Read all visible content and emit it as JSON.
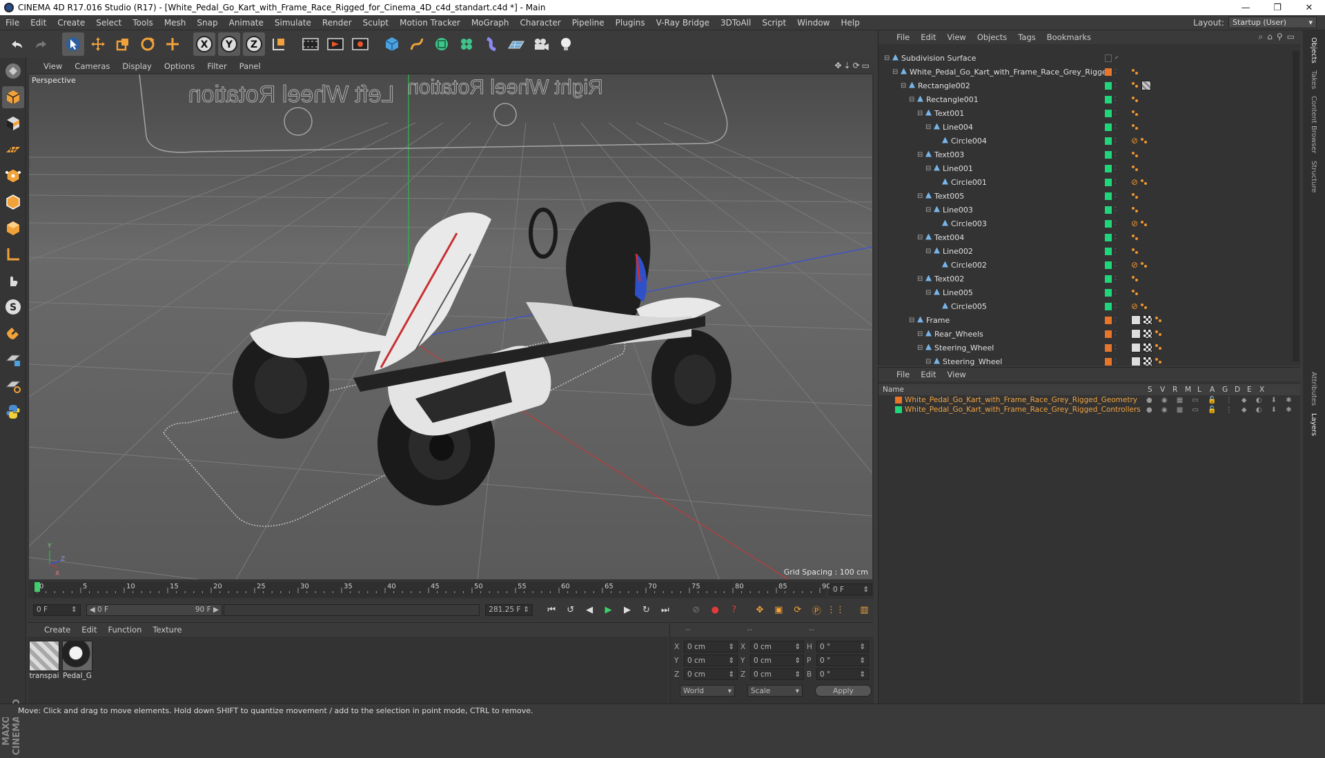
{
  "window": {
    "title": "CINEMA 4D R17.016 Studio (R17) - [White_Pedal_Go_Kart_with_Frame_Race_Rigged_for_Cinema_4D_c4d_standart.c4d *] - Main",
    "minimize": "—",
    "maximize": "❐",
    "close": "✕"
  },
  "menubar": {
    "items": [
      "File",
      "Edit",
      "Create",
      "Select",
      "Tools",
      "Mesh",
      "Snap",
      "Animate",
      "Simulate",
      "Render",
      "Sculpt",
      "Motion Tracker",
      "MoGraph",
      "Character",
      "Pipeline",
      "Plugins",
      "V-Ray Bridge",
      "3DToAll",
      "Script",
      "Window",
      "Help"
    ],
    "layout_label": "Layout:",
    "layout_value": "Startup (User)"
  },
  "toolbar": {
    "icons": [
      "undo-icon",
      "redo-icon",
      "select-icon",
      "move-icon",
      "scale-icon",
      "rotate-icon",
      "recent-tool-icon",
      "x-axis-icon",
      "y-axis-icon",
      "z-axis-icon",
      "world-coords-icon",
      "render-view-icon",
      "render-queue-icon",
      "render-settings-icon",
      "cube-icon",
      "pen-icon",
      "subdivision-icon",
      "cloner-icon",
      "deformer-icon",
      "floor-icon",
      "camera-icon",
      "light-icon"
    ],
    "axis_labels": [
      "X",
      "Y",
      "Z"
    ]
  },
  "left_tools": [
    "make-editable-icon",
    "model-mode-icon",
    "texture-mode-icon",
    "workplane-icon",
    "points-mode-icon",
    "edges-mode-icon",
    "polygons-mode-icon",
    "axis-mode-icon",
    "tweak-icon",
    "snap-icon",
    "magnet-icon",
    "grid-lock-icon",
    "grid-snap-icon",
    "python-icon"
  ],
  "maxon_logo": "MAXON CINEMA 4D",
  "viewport": {
    "menu": [
      "View",
      "Cameras",
      "Display",
      "Options",
      "Filter",
      "Panel"
    ],
    "label": "Perspective",
    "grid_spacing": "Grid Spacing : 100 cm",
    "overlay_text_left": "Left Wheel Rotation",
    "overlay_text_right": "Right Wheel Rotation",
    "axis_y": "Y",
    "axis_z": "Z",
    "axis_x": "X"
  },
  "timeline": {
    "ticks": [
      "0",
      "5",
      "10",
      "15",
      "20",
      "25",
      "30",
      "35",
      "40",
      "45",
      "50",
      "55",
      "60",
      "65",
      "70",
      "75",
      "80",
      "85",
      "90"
    ],
    "current_frame_end": "0 F"
  },
  "transport": {
    "start_frame": "0 F",
    "range_start": "◀ 0 F",
    "range_end": "90 F ▶",
    "fps_field": "281.25 F"
  },
  "material_manager": {
    "menu": [
      "Create",
      "Edit",
      "Function",
      "Texture"
    ],
    "materials": [
      {
        "label": "transpai"
      },
      {
        "label": "Pedal_G"
      }
    ]
  },
  "coordinates": {
    "header": [
      "--",
      "--",
      "--"
    ],
    "rows": [
      {
        "a": "X",
        "v1": "0 cm",
        "b": "X",
        "v2": "0 cm",
        "c": "H",
        "v3": "0 °"
      },
      {
        "a": "Y",
        "v1": "0 cm",
        "b": "Y",
        "v2": "0 cm",
        "c": "P",
        "v3": "0 °"
      },
      {
        "a": "Z",
        "v1": "0 cm",
        "b": "Z",
        "v2": "0 cm",
        "c": "B",
        "v3": "0 °"
      }
    ],
    "mode_world": "World",
    "mode_scale": "Scale",
    "apply": "Apply"
  },
  "object_manager": {
    "menu": [
      "File",
      "Edit",
      "View",
      "Objects",
      "Tags",
      "Bookmarks"
    ],
    "rows": [
      {
        "name": "Subdivision Surface",
        "level": 0,
        "layer": ""
      },
      {
        "name": "White_Pedal_Go_Kart_with_Frame_Race_Grey_Rigged",
        "level": 1,
        "layer": "#e8752a"
      },
      {
        "name": "Rectangle002",
        "level": 2,
        "layer": "#1fd67a"
      },
      {
        "name": "Rectangle001",
        "level": 3,
        "layer": "#1fd67a"
      },
      {
        "name": "Text001",
        "level": 4,
        "layer": "#1fd67a"
      },
      {
        "name": "Line004",
        "level": 5,
        "layer": "#1fd67a"
      },
      {
        "name": "Circle004",
        "level": 6,
        "layer": "#1fd67a"
      },
      {
        "name": "Text003",
        "level": 4,
        "layer": "#1fd67a"
      },
      {
        "name": "Line001",
        "level": 5,
        "layer": "#1fd67a"
      },
      {
        "name": "Circle001",
        "level": 6,
        "layer": "#1fd67a"
      },
      {
        "name": "Text005",
        "level": 4,
        "layer": "#1fd67a"
      },
      {
        "name": "Line003",
        "level": 5,
        "layer": "#1fd67a"
      },
      {
        "name": "Circle003",
        "level": 6,
        "layer": "#1fd67a"
      },
      {
        "name": "Text004",
        "level": 4,
        "layer": "#1fd67a"
      },
      {
        "name": "Line002",
        "level": 5,
        "layer": "#1fd67a"
      },
      {
        "name": "Circle002",
        "level": 6,
        "layer": "#1fd67a"
      },
      {
        "name": "Text002",
        "level": 4,
        "layer": "#1fd67a"
      },
      {
        "name": "Line005",
        "level": 5,
        "layer": "#1fd67a"
      },
      {
        "name": "Circle005",
        "level": 6,
        "layer": "#1fd67a"
      },
      {
        "name": "Frame",
        "level": 3,
        "layer": "#e8752a"
      },
      {
        "name": "Rear_Wheels",
        "level": 4,
        "layer": "#e8752a"
      },
      {
        "name": "Steering_Wheel",
        "level": 4,
        "layer": "#e8752a"
      },
      {
        "name": "Steering_Wheel",
        "level": 5,
        "layer": "#e8752a"
      }
    ]
  },
  "right_tabs": [
    "Objects",
    "Takes",
    "Content Browser",
    "Structure",
    "Attributes",
    "Layers"
  ],
  "layer_manager": {
    "menu": [
      "File",
      "Edit",
      "View"
    ],
    "columns": [
      "Name",
      "S",
      "V",
      "R",
      "M",
      "L",
      "A",
      "G",
      "D",
      "E",
      "X"
    ],
    "layers": [
      {
        "name": "White_Pedal_Go_Kart_with_Frame_Race_Grey_Rigged_Geometry",
        "color": "#e8752a"
      },
      {
        "name": "White_Pedal_Go_Kart_with_Frame_Race_Grey_Rigged_Controllers",
        "color": "#1fd67a"
      }
    ]
  },
  "status": "Move: Click and drag to move elements. Hold down SHIFT to quantize movement / add to the selection in point mode, CTRL to remove."
}
